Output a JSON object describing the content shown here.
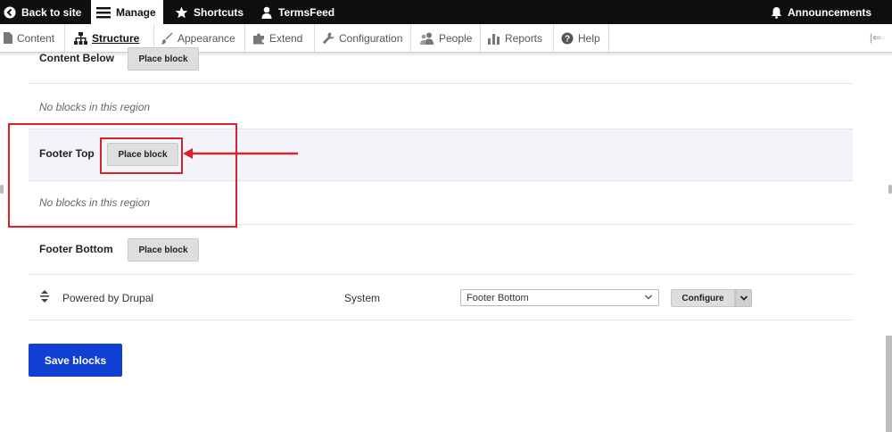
{
  "topbar": {
    "back_label": "Back to site",
    "manage_label": "Manage",
    "shortcuts_label": "Shortcuts",
    "user_label": "TermsFeed",
    "announcements_label": "Announcements"
  },
  "tray": {
    "items": [
      {
        "label": "Content",
        "icon": "page-icon"
      },
      {
        "label": "Structure",
        "icon": "sitemap-icon",
        "active": true
      },
      {
        "label": "Appearance",
        "icon": "paintbrush-icon"
      },
      {
        "label": "Extend",
        "icon": "puzzle-icon"
      },
      {
        "label": "Configuration",
        "icon": "wrench-icon"
      },
      {
        "label": "People",
        "icon": "people-icon"
      },
      {
        "label": "Reports",
        "icon": "bar-chart-icon"
      },
      {
        "label": "Help",
        "icon": "help-icon"
      }
    ]
  },
  "regions": [
    {
      "name": "Content Below",
      "button": "Place block",
      "empty": "No blocks in this region"
    },
    {
      "name": "Footer Top",
      "button": "Place block",
      "empty": "No blocks in this region"
    },
    {
      "name": "Footer Bottom",
      "button": "Place block"
    }
  ],
  "block_row": {
    "title": "Powered by Drupal",
    "category": "System",
    "region_value": "Footer Bottom",
    "configure_label": "Configure"
  },
  "save_label": "Save blocks",
  "colors": {
    "accent": "#0f3fd3",
    "annotation": "#d9222a",
    "topbar": "#0f0f0f"
  }
}
